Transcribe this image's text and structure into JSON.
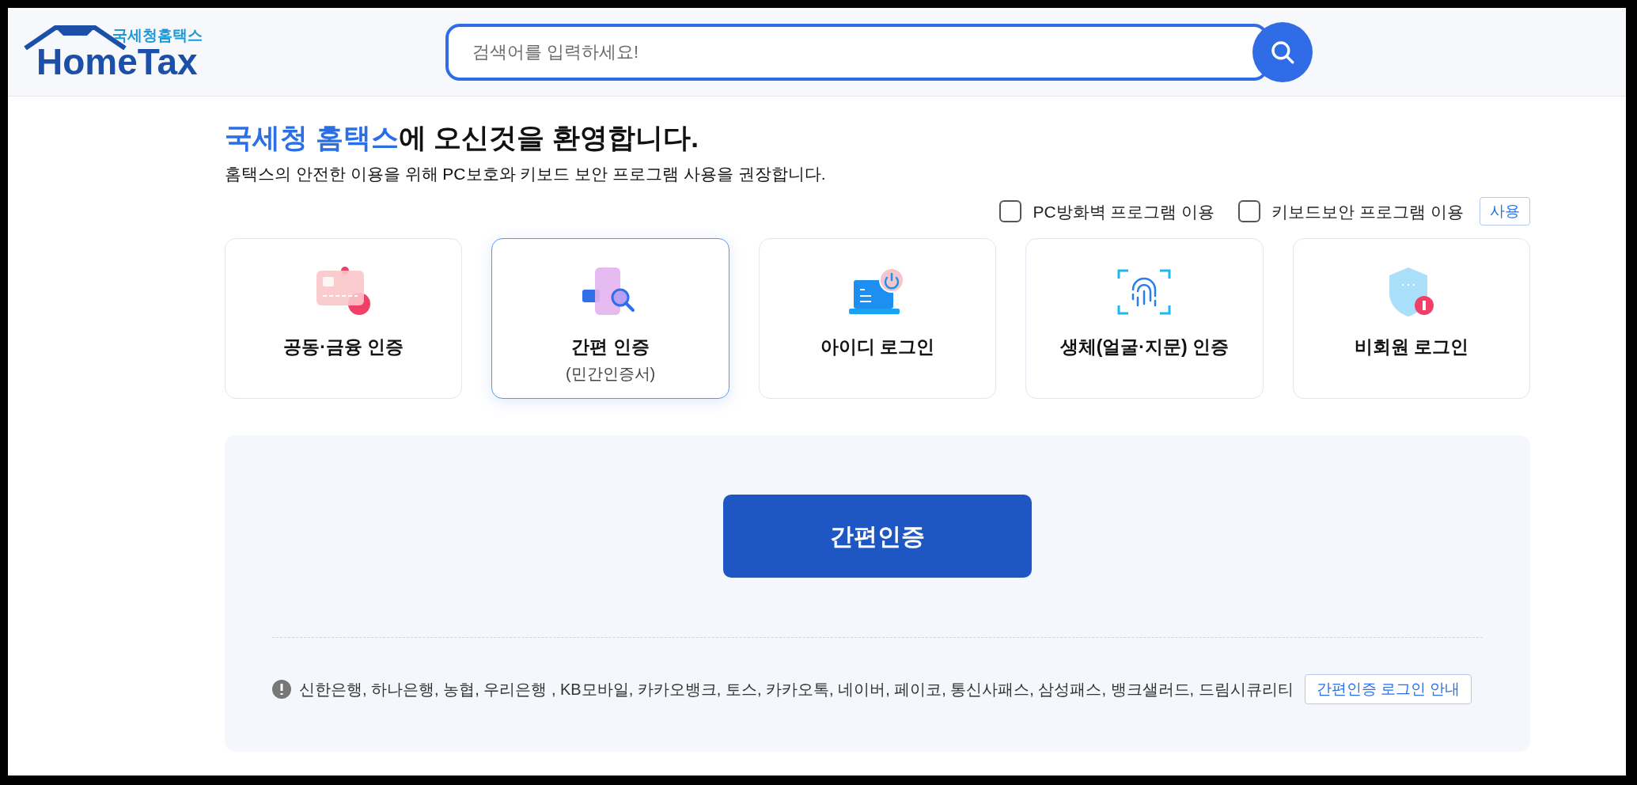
{
  "header": {
    "logo": {
      "subtitle": "국세청홈택스",
      "name": "HomeTax"
    },
    "search": {
      "placeholder": "검색어를 입력하세요!"
    }
  },
  "welcome": {
    "title_highlight": "국세청 홈택스",
    "title_rest": "에 오신것을 환영합니다.",
    "subtitle": "홈택스의 안전한 이용을 위해 PC보호와 키보드 보안 프로그램 사용을 권장합니다."
  },
  "options": [
    {
      "label": "PC방화벽 프로그램 이용",
      "checked": false
    },
    {
      "label": "키보드보안 프로그램 이용",
      "checked": false
    }
  ],
  "use_button": "사용",
  "methods": [
    {
      "kind": "card",
      "label": "공동·금융 인증",
      "selected": false
    },
    {
      "kind": "simple",
      "label": "간편 인증",
      "sublabel": "(민간인증서)",
      "selected": true
    },
    {
      "kind": "id",
      "label": "아이디 로그인",
      "selected": false
    },
    {
      "kind": "bio",
      "label": "생체(얼굴·지문) 인증",
      "selected": false
    },
    {
      "kind": "guest",
      "label": "비회원 로그인",
      "selected": false
    }
  ],
  "panel": {
    "button": "간편인증",
    "notice": "신한은행, 하나은행, 농협, 우리은행 , KB모바일, 카카오뱅크, 토스, 카카오톡, 네이버, 페이코, 통신사패스, 삼성패스, 뱅크샐러드, 드림시큐리티",
    "guide_link": "간편인증 로그인 안내"
  }
}
